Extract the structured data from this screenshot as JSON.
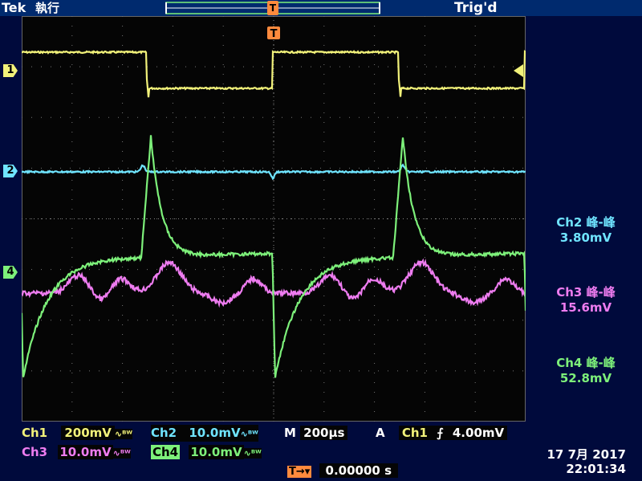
{
  "header": {
    "brand": "Tek",
    "mode": "執行",
    "trigger_status": "Trig'd",
    "trigger_marker": "T"
  },
  "channel_markers": {
    "ch1": "1",
    "ch2": "2",
    "ch4": "4"
  },
  "measurements": [
    {
      "title": "Ch2 峰-峰",
      "value": "3.80mV",
      "color": "#6fe4ff"
    },
    {
      "title": "Ch3 峰-峰",
      "value": "15.6mV",
      "color": "#ee7cf0"
    },
    {
      "title": "Ch4 峰-峰",
      "value": "52.8mV",
      "color": "#7df07a"
    }
  ],
  "bottom": {
    "ch1_label": "Ch1",
    "ch1_scale": "200mV",
    "ch2_label": "Ch2",
    "ch2_scale": "10.0mV",
    "ch3_label": "Ch3",
    "ch3_scale": "10.0mV",
    "ch4_label": "Ch4",
    "ch4_scale": "10.0mV",
    "bw_symbol": "∿ᴮᵂ",
    "timebase_label": "M",
    "timebase_value": "200µs",
    "trigger_label": "A",
    "trigger_source": "Ch1",
    "trigger_slope": "⨍",
    "trigger_level": "4.00mV",
    "position_marker": "T→▾",
    "position_value": "0.00000 s",
    "date": "17 7月  2017",
    "time": "22:01:34"
  },
  "colors": {
    "ch1": "#f2f27a",
    "ch2": "#6fe4ff",
    "ch3": "#ee7cf0",
    "ch4": "#7df07a",
    "trigger": "#ff8a3d"
  }
}
